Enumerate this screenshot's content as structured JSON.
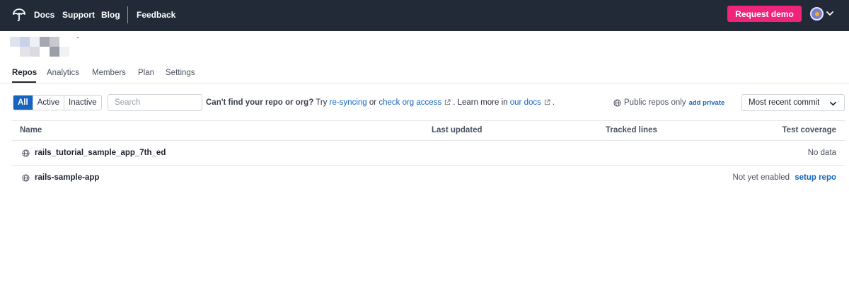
{
  "nav": {
    "links": [
      {
        "label": "Docs"
      },
      {
        "label": "Support"
      },
      {
        "label": "Blog"
      },
      {
        "label": "Feedback"
      }
    ],
    "request_demo": "Request demo",
    "accent": "#f0247a",
    "background": "#222a38"
  },
  "tabs": [
    {
      "label": "Repos",
      "active": true
    },
    {
      "label": "Analytics"
    },
    {
      "label": "Members"
    },
    {
      "label": "Plan"
    },
    {
      "label": "Settings"
    }
  ],
  "filters": {
    "segments": [
      "All",
      "Active",
      "Inactive"
    ],
    "selected": "All",
    "search_placeholder": "Search",
    "help_lead": "Can't find your repo or org?",
    "help_try": "Try",
    "resync_link": "re-syncing",
    "help_or": "or",
    "access_link": "check org access",
    "help_learn": ". Learn more in",
    "docs_link": "our docs",
    "help_end": ".",
    "public_only": "Public repos only",
    "add_private": "add private",
    "sort": "Most recent commit"
  },
  "table": {
    "columns": [
      "Name",
      "Last updated",
      "Tracked lines",
      "Test coverage"
    ],
    "rows": [
      {
        "name": "rails_tutorial_sample_app_7th_ed",
        "last_updated": "",
        "tracked_lines": "",
        "coverage_text": "No data",
        "coverage_link": ""
      },
      {
        "name": "rails-sample-app",
        "last_updated": "",
        "tracked_lines": "",
        "coverage_text": "Not yet enabled",
        "coverage_link": "setup repo"
      }
    ]
  },
  "colors": {
    "link": "#1565c0",
    "active_segment": "#1565c0"
  }
}
